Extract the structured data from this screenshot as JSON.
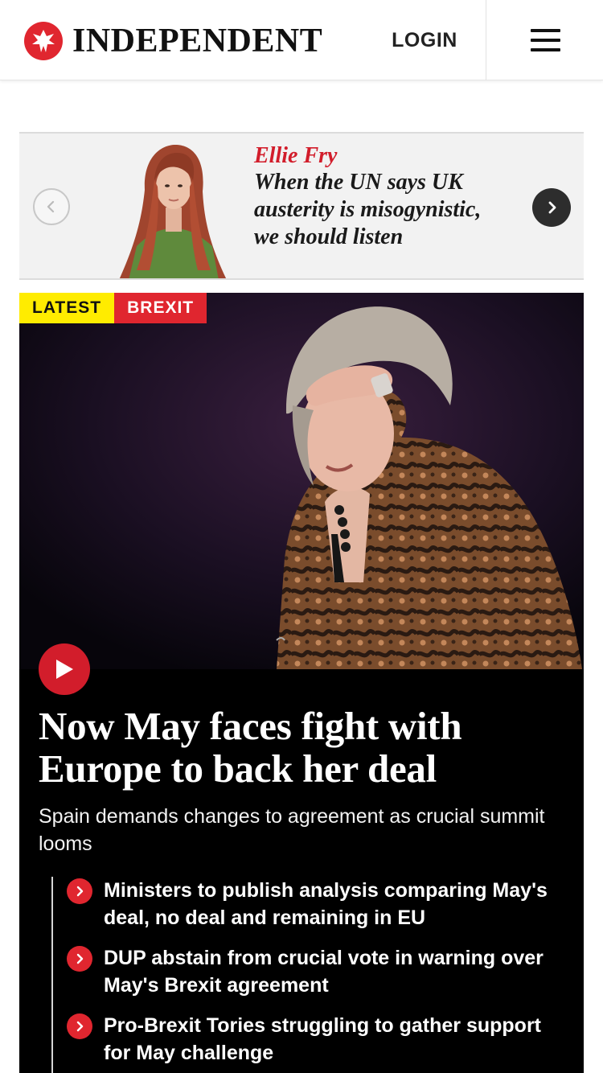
{
  "header": {
    "brand": "INDEPENDENT",
    "login_label": "LOGIN",
    "brand_color": "#e0262f"
  },
  "opinion": {
    "author": "Ellie Fry",
    "headline": "When the UN says UK austerity is misogynistic, we should listen",
    "prev_icon": "chevron-left-icon",
    "next_icon": "chevron-right-icon"
  },
  "lead_story": {
    "tags": [
      "LATEST",
      "BREXIT"
    ],
    "tag_colors": [
      "#ffec00",
      "#e0262f"
    ],
    "headline": "Now May faces fight with Europe to back her deal",
    "standfirst": "Spain demands changes to agreement as crucial summit looms",
    "play_icon": "play-icon",
    "related": [
      "Ministers to publish analysis comparing May's deal, no deal and remaining in EU",
      "DUP abstain from crucial vote in warning over May's Brexit agreement",
      "Pro-Brexit Tories struggling to gather support for May challenge"
    ]
  }
}
